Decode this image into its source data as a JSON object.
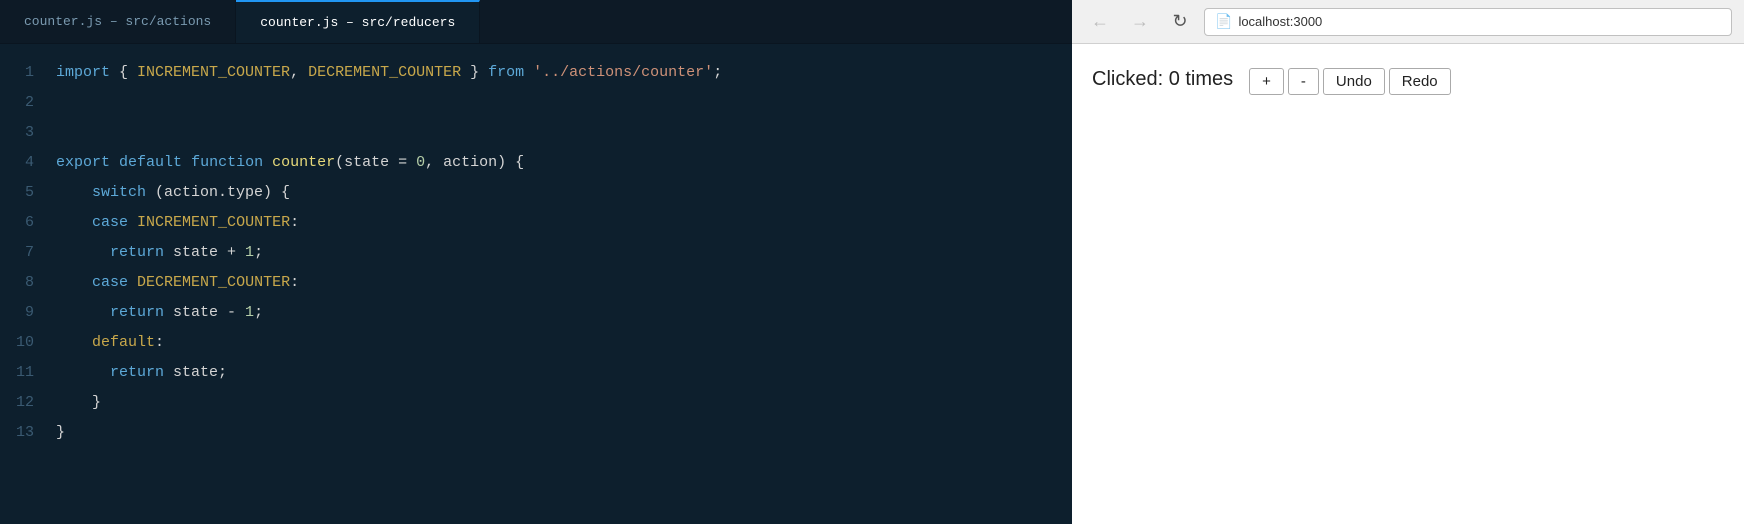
{
  "tabs": {
    "inactive": {
      "label": "counter.js – src/actions"
    },
    "active": {
      "label": "counter.js – src/reducers"
    }
  },
  "lines": {
    "numbers": [
      1,
      2,
      3,
      4,
      5,
      6,
      7,
      8,
      9,
      10,
      11,
      12,
      13
    ]
  },
  "browser": {
    "back_label": "←",
    "forward_label": "→",
    "reload_label": "↻",
    "url": "localhost:3000",
    "counter_text": "Clicked: 0 times",
    "btn_increment": "+",
    "btn_decrement": "-",
    "btn_undo": "Undo",
    "btn_redo": "Redo"
  }
}
